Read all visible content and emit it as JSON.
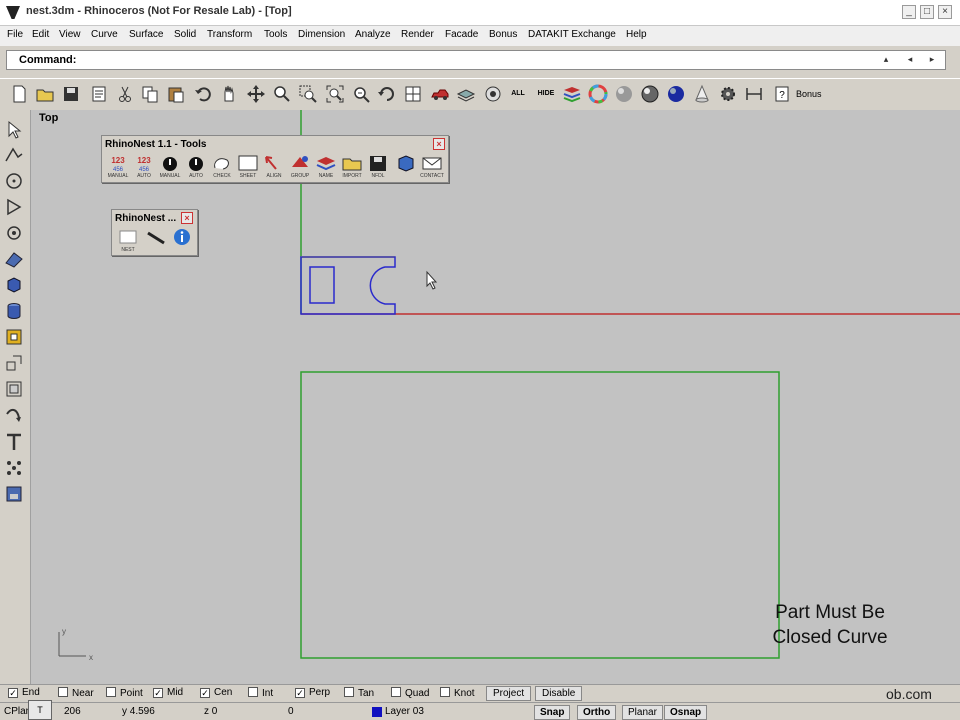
{
  "window": {
    "title": "nest.3dm - Rhinoceros (Not For Resale Lab) - [Top]",
    "controls": [
      "_",
      "□",
      "×"
    ]
  },
  "menubar": {
    "items": [
      "File",
      "Edit",
      "View",
      "Curve",
      "Surface",
      "Solid",
      "Transform",
      "Tools",
      "Dimension",
      "Analyze",
      "Render",
      "Facade",
      "Bonus",
      "DATAKIT Exchange",
      "Help"
    ]
  },
  "command": {
    "label": "Command:",
    "value": ""
  },
  "main_toolbar": {
    "icons": [
      "new-file-icon",
      "open-icon",
      "save-icon",
      "print-icon",
      "cut-icon",
      "copy-icon",
      "paste-icon",
      "undo-icon",
      "pan-hand-icon",
      "move-view-icon",
      "zoom-icon",
      "zoom-window-icon",
      "zoom-extents-icon",
      "zoom-selected-icon",
      "rotate-view-icon",
      "four-viewports-icon",
      "car-icon",
      "layers-icon",
      "show-icon",
      "show-all-icon",
      "hide-icon",
      "layer-stack-icon",
      "color-wheel-icon",
      "shaded-sphere-icon",
      "rendered-sphere-icon",
      "blue-sphere-icon",
      "cone-icon",
      "gear-icon",
      "dimension-icon",
      "help-icon"
    ],
    "bonus_label": "Bonus",
    "all_label": "ALL",
    "hide_label": "HIDE"
  },
  "left_toolbar": {
    "icons": [
      "select-arrow-icon",
      "polyline-icon",
      "circle-icon",
      "polygon-icon",
      "point-icon",
      "surface-icon",
      "box-icon",
      "cylinder-icon",
      "solid-tools-icon",
      "transform-icon",
      "array-icon",
      "curve-tools-icon",
      "text-icon",
      "grid-points-icon",
      "render-icon"
    ]
  },
  "viewport": {
    "title": "Top",
    "axis_x": "x",
    "axis_y": "y",
    "colors": {
      "x_axis": "#c03030",
      "y_axis": "#30a030",
      "part": "#2a2acc",
      "sheet": "#30a030",
      "highlight": "#e0d040"
    }
  },
  "rhinonest_tools": {
    "title": "RhinoNest 1.1 - Tools",
    "close": "×",
    "buttons": [
      {
        "name": "manual-nest",
        "label": "MANUAL"
      },
      {
        "name": "auto-nest",
        "label": "AUTO"
      },
      {
        "name": "manual-bomb",
        "label": "MANUAL"
      },
      {
        "name": "auto-bomb",
        "label": "AUTO"
      },
      {
        "name": "check",
        "label": "CHECK"
      },
      {
        "name": "sheet",
        "label": "SHEET"
      },
      {
        "name": "align",
        "label": "ALIGN"
      },
      {
        "name": "group",
        "label": "GROUP"
      },
      {
        "name": "name",
        "label": "NAME"
      },
      {
        "name": "import",
        "label": "IMPORT"
      },
      {
        "name": "nfdl",
        "label": "NFDL"
      },
      {
        "name": "box",
        "label": ""
      },
      {
        "name": "contact",
        "label": "CONTACT"
      }
    ]
  },
  "rhinonest_small": {
    "title": "RhinoNest ...",
    "close": "×",
    "buttons": [
      {
        "name": "nest",
        "label": "NEST"
      },
      {
        "name": "wand",
        "label": ""
      },
      {
        "name": "info",
        "label": ""
      }
    ]
  },
  "caption": {
    "line1": "Part Must Be",
    "line2": "Closed Curve"
  },
  "osnaps": [
    {
      "label": "End",
      "checked": true
    },
    {
      "label": "Near",
      "checked": false
    },
    {
      "label": "Point",
      "checked": false
    },
    {
      "label": "Mid",
      "checked": true
    },
    {
      "label": "Cen",
      "checked": true
    },
    {
      "label": "Int",
      "checked": false
    },
    {
      "label": "Perp",
      "checked": true
    },
    {
      "label": "Tan",
      "checked": false
    },
    {
      "label": "Quad",
      "checked": false
    },
    {
      "label": "Knot",
      "checked": false
    }
  ],
  "osnap_buttons": {
    "project": "Project",
    "disable": "Disable"
  },
  "watermark": "ob.com",
  "status": {
    "cplane": "CPlan",
    "x": "206",
    "y": "y 4.596",
    "z": "z 0",
    "dist": "0",
    "layer": "Layer 03",
    "snap": "Snap",
    "ortho": "Ortho",
    "planar": "Planar",
    "osnap": "Osnap",
    "taskbar_stub": "T"
  }
}
